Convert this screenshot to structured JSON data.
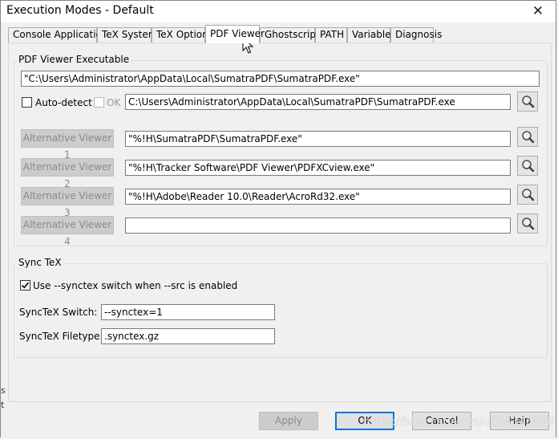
{
  "window": {
    "title": "Execution Modes - Default"
  },
  "tabs": [
    {
      "label": "Console Applications"
    },
    {
      "label": "TeX System"
    },
    {
      "label": "TeX Options"
    },
    {
      "label": "PDF Viewer"
    },
    {
      "label": "Ghostscript"
    },
    {
      "label": "PATH"
    },
    {
      "label": "Variables"
    },
    {
      "label": "Diagnosis"
    }
  ],
  "active_tab": "PDF Viewer",
  "pdf_viewer": {
    "group_label": "PDF Viewer Executable",
    "executable": "\"C:\\Users\\Administrator\\AppData\\Local\\SumatraPDF\\SumatraPDF.exe\"",
    "auto_detect_label": "Auto-detect",
    "auto_detect_checked": false,
    "ok_label": "OK",
    "ok_checked": false,
    "detected_path": "C:\\Users\\Administrator\\AppData\\Local\\SumatraPDF\\SumatraPDF.exe",
    "alternatives": [
      {
        "label": "Alternative Viewer 1",
        "value": "\"%!H\\SumatraPDF\\SumatraPDF.exe\""
      },
      {
        "label": "Alternative Viewer 2",
        "value": "\"%!H\\Tracker Software\\PDF Viewer\\PDFXCview.exe\""
      },
      {
        "label": "Alternative Viewer 3",
        "value": "\"%!H\\Adobe\\Reader 10.0\\Reader\\AcroRd32.exe\""
      },
      {
        "label": "Alternative Viewer 4",
        "value": ""
      }
    ]
  },
  "synctex": {
    "group_label": "Sync TeX",
    "use_switch_label": "Use --synctex switch when --src is enabled",
    "use_switch_checked": true,
    "switch_label": "SyncTeX Switch:",
    "switch_value": "--synctex=1",
    "filetype_label": "SyncTeX Filetype:",
    "filetype_value": ".synctex.gz"
  },
  "buttons": {
    "apply": "Apply",
    "ok": "OK",
    "cancel": "Cancel",
    "help": "Help"
  },
  "watermark": "https://blog.csdn.net/u014346828",
  "edge_fragments": [
    "s",
    "t"
  ],
  "colors": {
    "default_button_border": "#0078d7",
    "disabled_button": "#cccccc"
  }
}
